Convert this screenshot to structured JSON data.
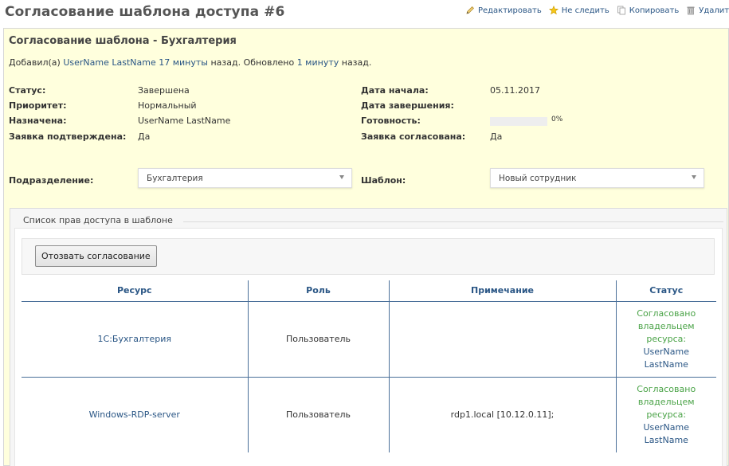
{
  "page": {
    "title": "Согласование шаблона доступа #6"
  },
  "actions": {
    "edit": "Редактировать",
    "unwatch": "Не следить",
    "copy": "Копировать",
    "delete": "Удалить"
  },
  "issue": {
    "subject": "Согласование шаблона - Бухгалтерия",
    "author_prefix": "Добавил(а)",
    "author": "UserName LastName",
    "created_ago": "17 минуты",
    "created_suffix": "назад. Обновлено",
    "updated_ago": "1 минуту",
    "updated_suffix": "назад.",
    "attributes": {
      "status_label": "Статус:",
      "status": "Завершена",
      "priority_label": "Приоритет:",
      "priority": "Нормальный",
      "assignee_label": "Назначена:",
      "assignee": "UserName LastName",
      "confirmed_label": "Заявка подтверждена:",
      "confirmed": "Да",
      "start_label": "Дата начала:",
      "start": "05.11.2017",
      "due_label": "Дата завершения:",
      "due": "",
      "done_label": "Готовность:",
      "done": "0%",
      "done_ratio": 0,
      "approved_label": "Заявка согласована:",
      "approved": "Да"
    },
    "department_label": "Подразделение:",
    "department_value": "Бухгалтерия",
    "template_label": "Шаблон:",
    "template_value": "Новый сотрудник"
  },
  "access_list": {
    "legend": "Список прав доступа в шаблоне",
    "revoke_button": "Отозвать согласование",
    "columns": [
      "Ресурс",
      "Роль",
      "Примечание",
      "Статус"
    ],
    "rows": [
      {
        "resource": "1С:Бухгалтерия",
        "role": "Пользователь",
        "note": "",
        "status_lines": [
          "Согласовано",
          "владельцем",
          "ресурса:"
        ],
        "status_user": [
          "UserName",
          "LastName"
        ]
      },
      {
        "resource": "Windows-RDP-server",
        "role": "Пользователь",
        "note": "rdp1.local [10.12.0.11];",
        "status_lines": [
          "Согласовано",
          "владельцем",
          "ресурса:"
        ],
        "status_user": [
          "UserName",
          "LastName"
        ]
      }
    ]
  },
  "icons": {
    "edit": "pencil-icon",
    "unwatch": "star-icon",
    "copy": "copy-icon",
    "delete": "trash-icon"
  },
  "colors": {
    "link": "#2a5685",
    "issue_background": "#ffffdd",
    "status_approved": "#4aa347"
  }
}
